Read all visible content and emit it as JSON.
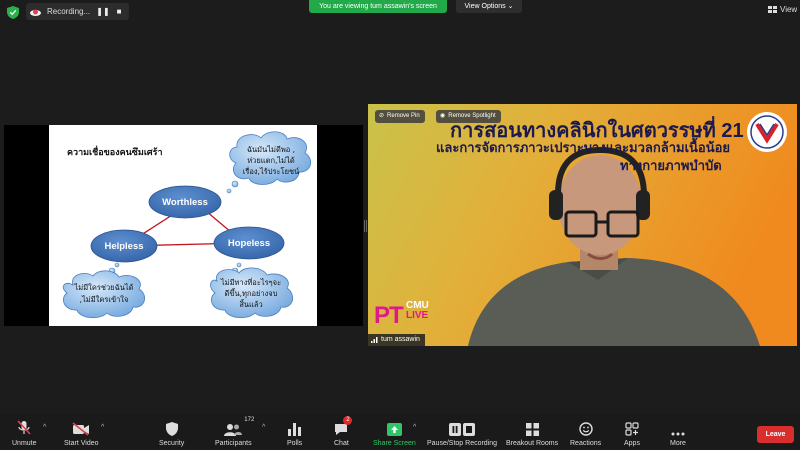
{
  "topbar": {
    "recording_label": "Recording...",
    "banner_text": "You are viewing tum assawin's screen",
    "view_options_label": "View Options",
    "view_label": "View"
  },
  "shared_slide": {
    "title": "ความเชื่อของคนซึมเศร้า",
    "nodes": {
      "top": "Worthless",
      "left": "Helpless",
      "right": "Hopeless"
    },
    "clouds": {
      "top_right": [
        "ฉันมันไม่ดีพอ ,",
        "ห่วยแตก,ไม่ได้",
        "เรื่อง,ไร้ประโยชน์"
      ],
      "bottom_left": [
        "ไม่มีใครช่วยฉันได้",
        ",ไม่มีใครเข้าใจ"
      ],
      "bottom_right": [
        "ไม่มีทางที่อะไรๆจะ",
        "ดีขึ้น,ทุกอย่างจบ",
        "สิ้นแล้ว"
      ]
    }
  },
  "video": {
    "remove_pin_label": "Remove Pin",
    "remove_spotlight_label": "Remove Spotlight",
    "heading": "การสอนทางคลินิกในศตวรรษที่ 21",
    "subheading_1": "และการจัดการภาวะเปราะบางและมวลกล้ามเนื้อน้อย",
    "subheading_2": "ทางกายภาพบำบัด",
    "logo_pt": "PT",
    "logo_cmu": "CMU",
    "logo_live": "LIVE",
    "participant_name": "tum assawin"
  },
  "toolbar": {
    "unmute": "Unmute",
    "start_video": "Start Video",
    "security": "Security",
    "participants": "Participants",
    "participants_count": "172",
    "polls": "Polls",
    "chat": "Chat",
    "chat_badge": "2",
    "share_screen": "Share Screen",
    "record": "Pause/Stop Recording",
    "breakout": "Breakout Rooms",
    "reactions": "Reactions",
    "apps": "Apps",
    "more": "More",
    "leave": "Leave"
  },
  "colors": {
    "banner_green": "#22a94a",
    "share_green": "#2ec766",
    "leave_red": "#d92e2e",
    "node_blue": "#3b6fb6",
    "cloud_blue": "#6fa5dc",
    "slide_navy": "#1b1a50"
  }
}
